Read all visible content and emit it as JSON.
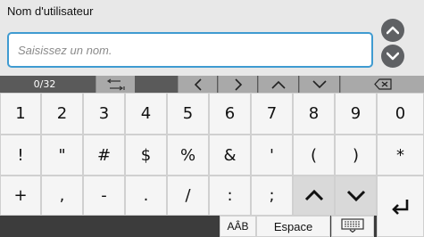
{
  "header": {
    "title": "Nom d'utilisateur",
    "input_value": "",
    "input_placeholder": "Saisissez un nom."
  },
  "toolbar": {
    "counter": "0/32"
  },
  "keyboard": {
    "row1": [
      "1",
      "2",
      "3",
      "4",
      "5",
      "6",
      "7",
      "8",
      "9",
      "0"
    ],
    "row2": [
      "!",
      "\"",
      "#",
      "$",
      "%",
      "&",
      "'",
      "(",
      ")",
      "*"
    ],
    "row3": [
      "+",
      ",",
      "-",
      ".",
      "/",
      ":",
      ";"
    ],
    "case_label": "AÂB",
    "space_label": "Espace"
  }
}
